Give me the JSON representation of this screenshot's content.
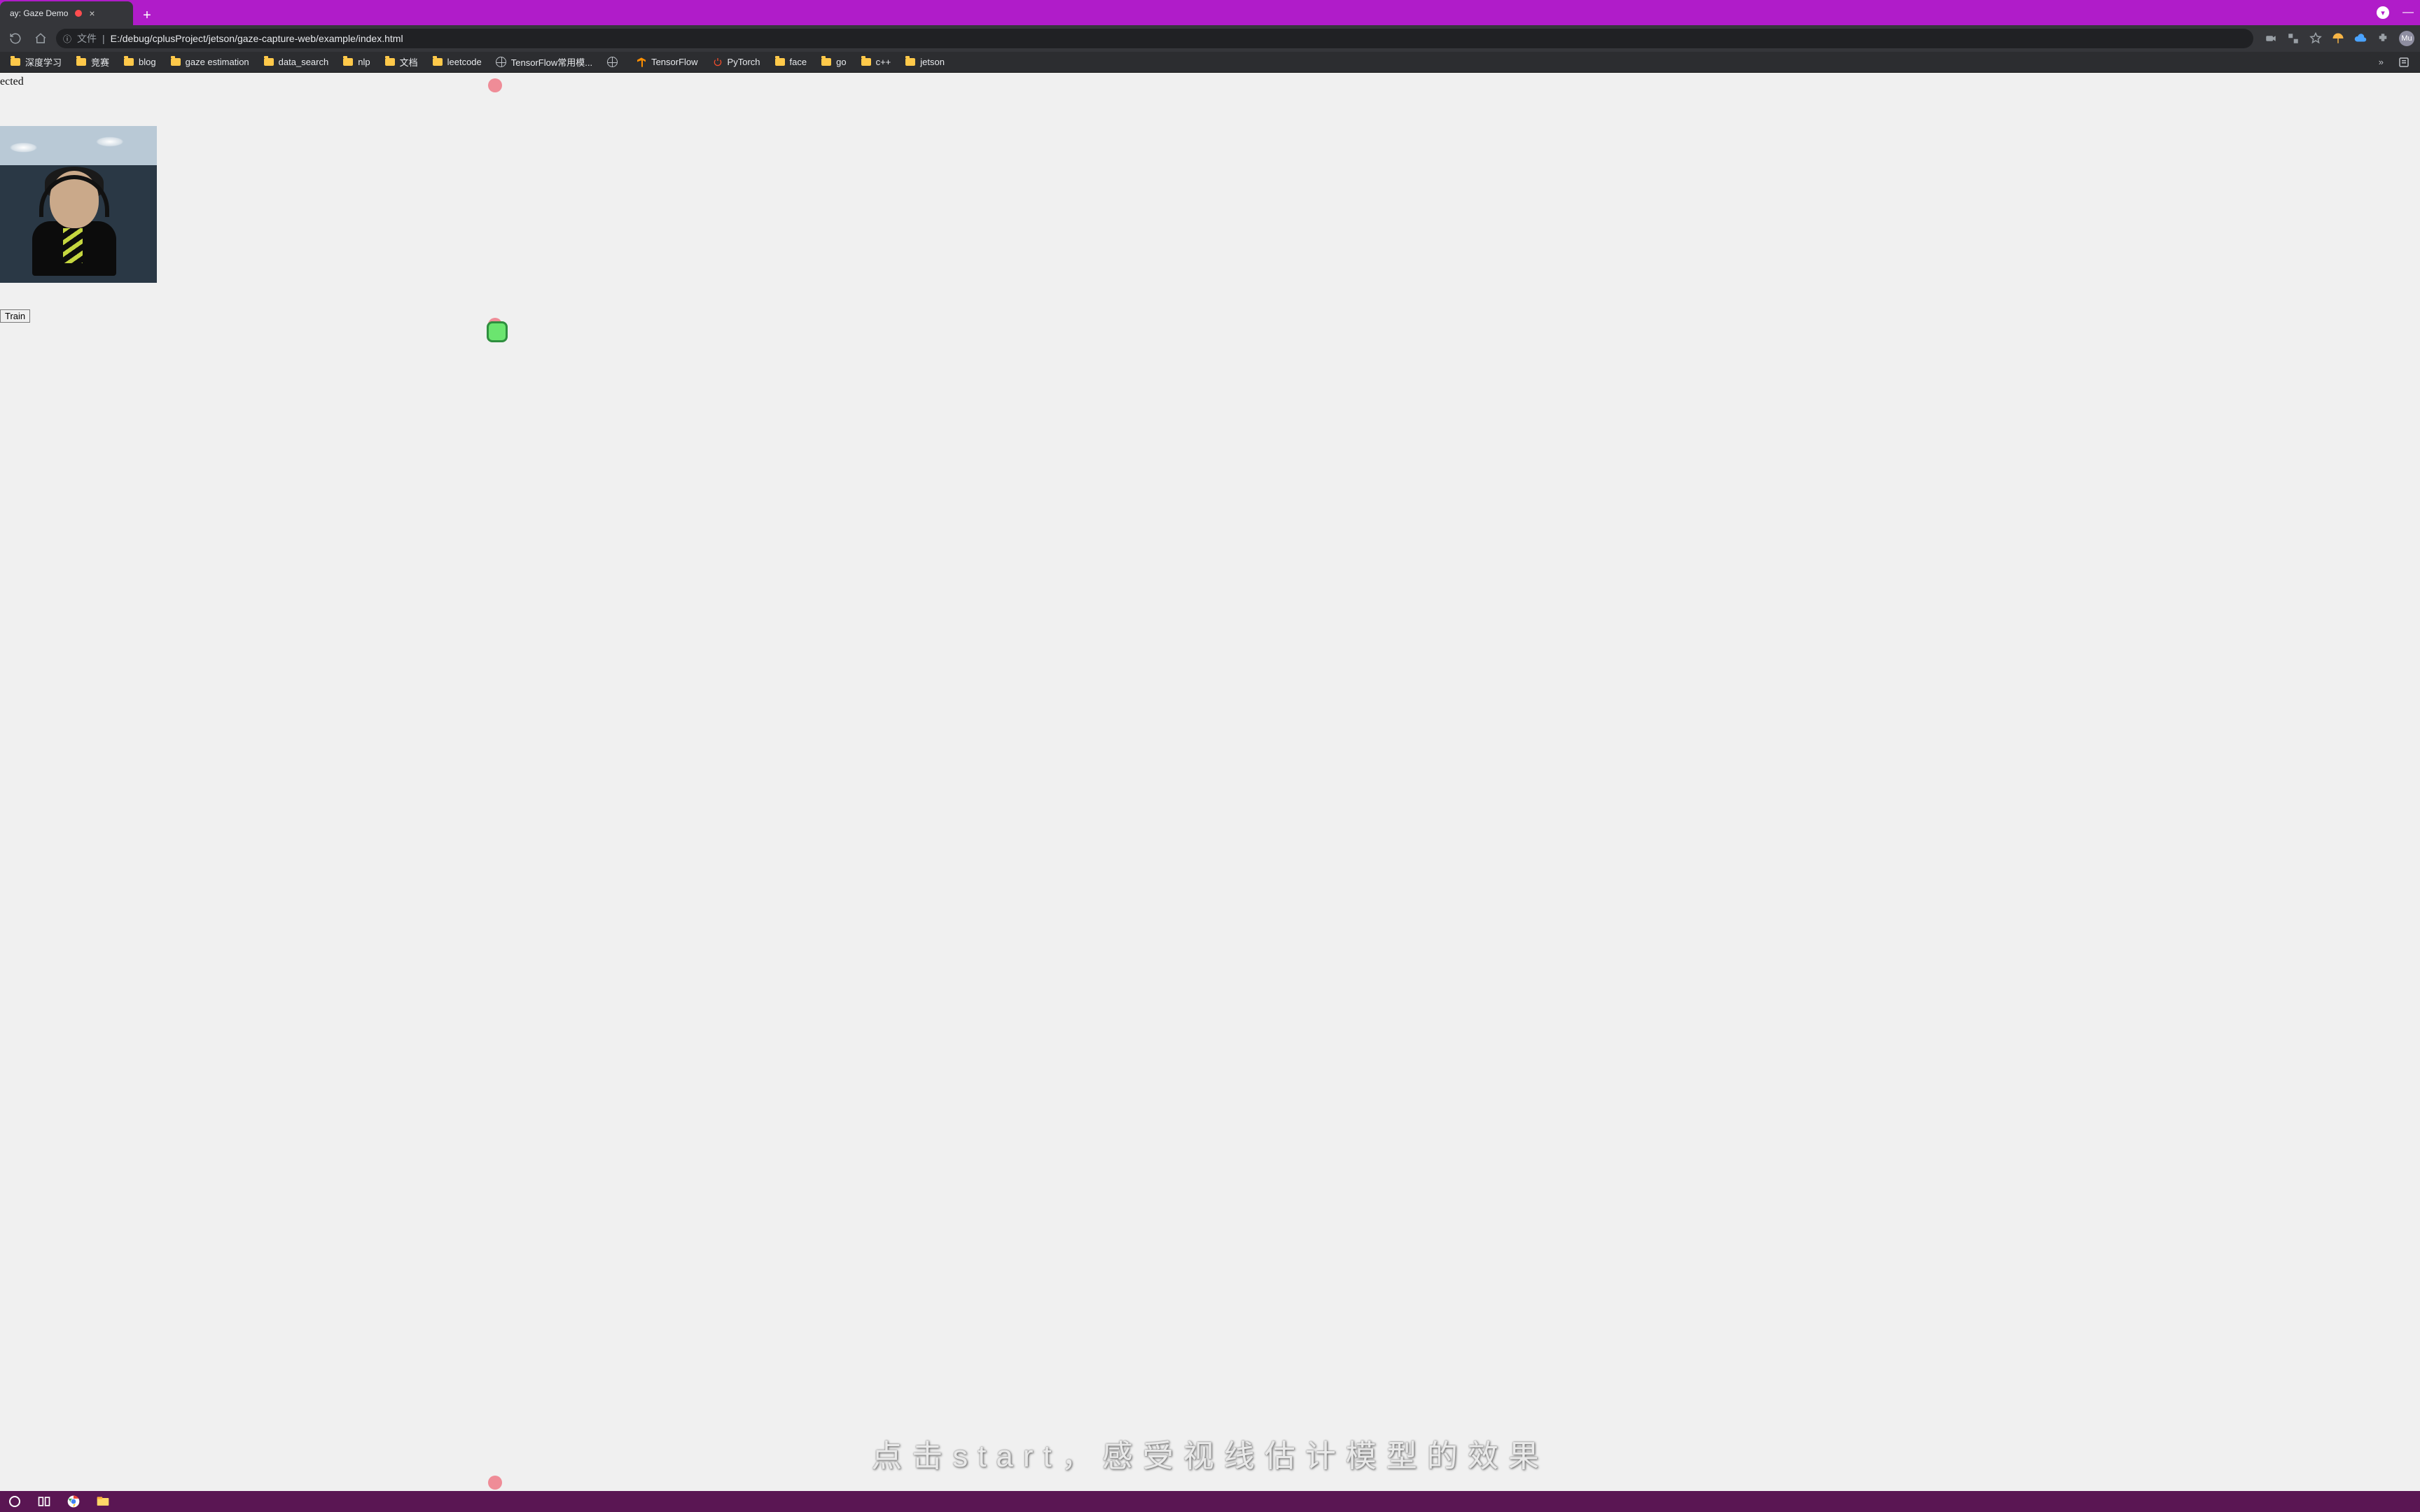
{
  "tab": {
    "title": "ay: Gaze Demo",
    "recording": true
  },
  "address": {
    "info_label": "文件",
    "separator": "|",
    "url": "E:/debug/cplusProject/jetson/gaze-capture-web/example/index.html"
  },
  "bookmarks": [
    {
      "icon": "folder",
      "label": "深度学习"
    },
    {
      "icon": "folder",
      "label": "竞赛"
    },
    {
      "icon": "folder",
      "label": "blog"
    },
    {
      "icon": "folder",
      "label": "gaze estimation"
    },
    {
      "icon": "folder",
      "label": "data_search"
    },
    {
      "icon": "folder",
      "label": "nlp"
    },
    {
      "icon": "folder",
      "label": "文档"
    },
    {
      "icon": "folder",
      "label": "leetcode"
    },
    {
      "icon": "globe",
      "label": "TensorFlow常用模..."
    },
    {
      "icon": "globe",
      "label": ""
    },
    {
      "icon": "tf",
      "label": "TensorFlow"
    },
    {
      "icon": "pt",
      "label": "PyTorch"
    },
    {
      "icon": "folder",
      "label": "face"
    },
    {
      "icon": "folder",
      "label": "go"
    },
    {
      "icon": "folder",
      "label": "c++"
    },
    {
      "icon": "folder",
      "label": "jetson"
    }
  ],
  "bookmarks_overflow": "»",
  "page": {
    "status_text": "ected",
    "train_button": "Train",
    "subtitle": "点击start，感受视线估计模型的效果"
  },
  "avatar_initials": "Mu"
}
